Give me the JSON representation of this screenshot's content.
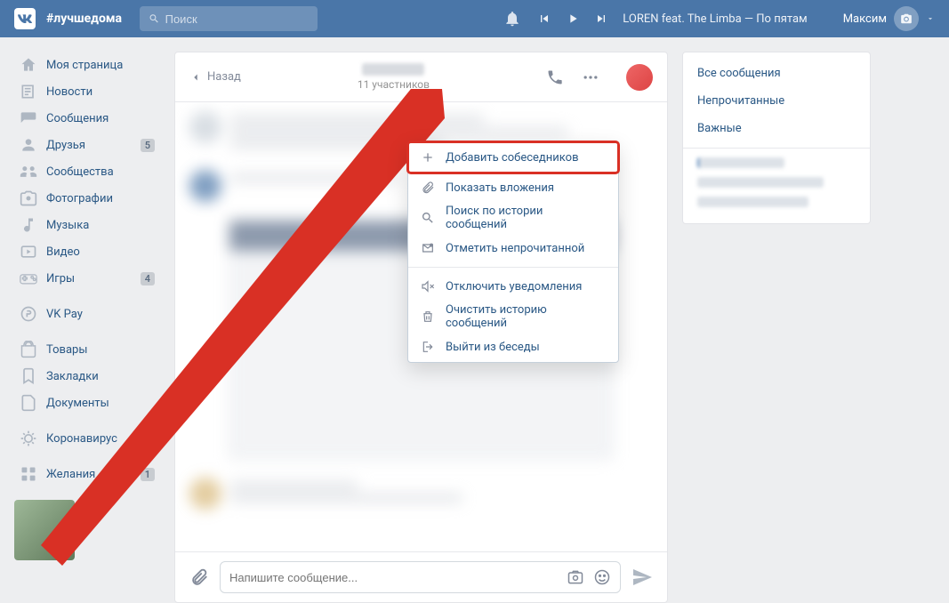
{
  "header": {
    "hashtag": "#лучшедома",
    "search_placeholder": "Поиск",
    "player_track": "LOREN feat. The Limba — По пятам",
    "username": "Максим"
  },
  "sidebar": {
    "items": [
      {
        "icon": "home",
        "label": "Моя страница"
      },
      {
        "icon": "news",
        "label": "Новости"
      },
      {
        "icon": "msg",
        "label": "Сообщения"
      },
      {
        "icon": "friends",
        "label": "Друзья",
        "badge": "5"
      },
      {
        "icon": "groups",
        "label": "Сообщества"
      },
      {
        "icon": "photos",
        "label": "Фотографии"
      },
      {
        "icon": "music",
        "label": "Музыка"
      },
      {
        "icon": "video",
        "label": "Видео"
      },
      {
        "icon": "games",
        "label": "Игры",
        "badge": "4"
      }
    ],
    "items2": [
      {
        "icon": "vkpay",
        "label": "VK Pay"
      }
    ],
    "items3": [
      {
        "icon": "market",
        "label": "Товары"
      },
      {
        "icon": "bookmark",
        "label": "Закладки"
      },
      {
        "icon": "docs",
        "label": "Документы"
      }
    ],
    "items4": [
      {
        "icon": "corona",
        "label": "Коронавирус"
      }
    ],
    "items5": [
      {
        "icon": "apps",
        "label": "Желания",
        "badge": "1"
      }
    ]
  },
  "chat": {
    "back_label": "Назад",
    "participants": "11 участников",
    "input_placeholder": "Напишите сообщение..."
  },
  "dropdown": {
    "items": [
      {
        "icon": "plus",
        "label": "Добавить собеседников",
        "highlight": true
      },
      {
        "icon": "attach",
        "label": "Показать вложения"
      },
      {
        "icon": "search",
        "label": "Поиск по истории сообщений"
      },
      {
        "icon": "unread",
        "label": "Отметить непрочитанной"
      }
    ],
    "items2": [
      {
        "icon": "mute",
        "label": "Отключить уведомления"
      },
      {
        "icon": "trash",
        "label": "Очистить историю сообщений"
      },
      {
        "icon": "exit",
        "label": "Выйти из беседы"
      }
    ]
  },
  "filters": {
    "items": [
      "Все сообщения",
      "Непрочитанные",
      "Важные"
    ]
  }
}
